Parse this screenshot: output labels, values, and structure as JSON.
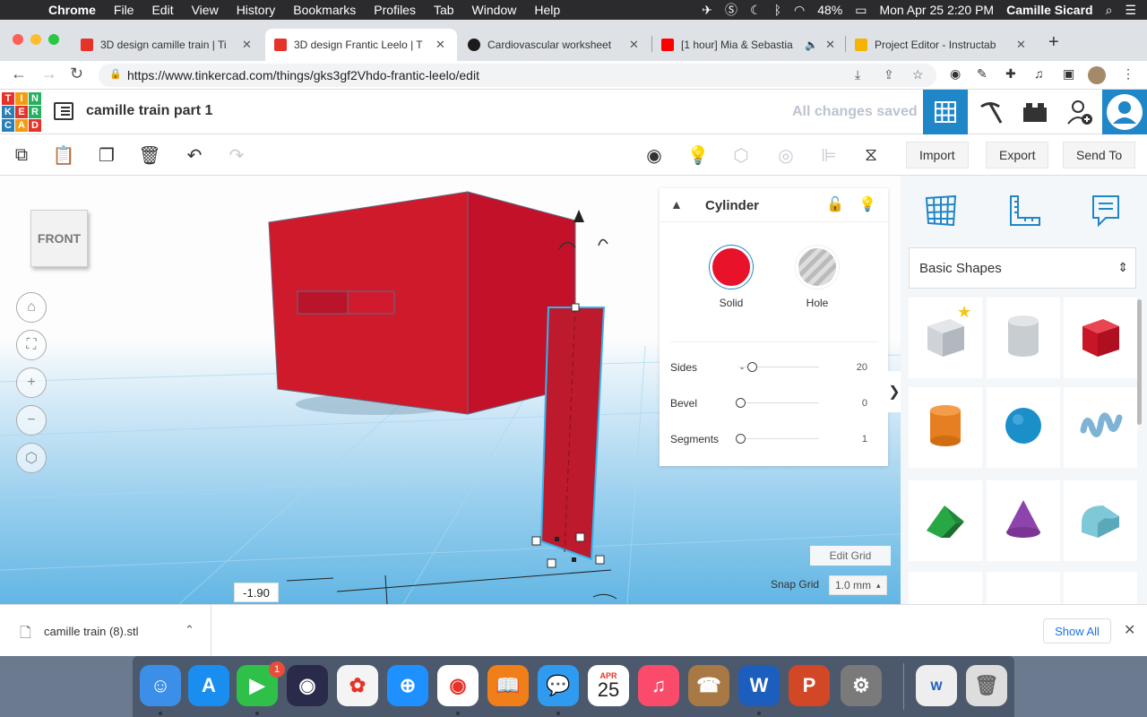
{
  "menubar": {
    "app": "Chrome",
    "items": [
      "File",
      "Edit",
      "View",
      "History",
      "Bookmarks",
      "Profiles",
      "Tab",
      "Window",
      "Help"
    ],
    "battery": "48%",
    "clock": "Mon Apr 25  2:20 PM",
    "user": "Camille Sicard"
  },
  "tabs": [
    {
      "title": "3D design camille train | Ti",
      "favicon_color": "#e6332a"
    },
    {
      "title": "3D design Frantic Leelo | T",
      "favicon_color": "#e6332a",
      "active": true
    },
    {
      "title": "Cardiovascular worksheet",
      "favicon_color": "#1b1b1b"
    },
    {
      "title": "[1 hour] Mia & Sebastia",
      "favicon_color": "#ff0000"
    },
    {
      "title": "Project Editor - Instructab",
      "favicon_color": "#f5b400"
    }
  ],
  "address": {
    "url": "https://www.tinkercad.com/things/gks3gf2Vhdo-frantic-leelo/edit"
  },
  "header": {
    "logo_letters": [
      "T",
      "I",
      "N",
      "K",
      "E",
      "R",
      "C",
      "A",
      "D"
    ],
    "logo_colors": [
      "#e6332a",
      "#f39c12",
      "#27ae60",
      "#2980b9",
      "#e6332a",
      "#27ae60",
      "#2980b9",
      "#f39c12",
      "#e6332a"
    ],
    "title": "camille train part 1",
    "status": "All changes saved",
    "accent": "#1f86c8"
  },
  "toolbar": {
    "import": "Import",
    "export": "Export",
    "send_to": "Send To"
  },
  "viewcube": {
    "label": "FRONT"
  },
  "inspector": {
    "name": "Cylinder",
    "solid_label": "Solid",
    "hole_label": "Hole",
    "solid_color": "#e8132a",
    "props": [
      {
        "label": "Sides",
        "value": "20",
        "min_label": "-",
        "level": 0.1
      },
      {
        "label": "Bevel",
        "value": "0",
        "min_label": "",
        "level": 0
      },
      {
        "label": "Segments",
        "value": "1",
        "min_label": "",
        "level": 0
      }
    ]
  },
  "workplane": {
    "dimension": "-1.90",
    "edit_grid": "Edit Grid",
    "snap_label": "Snap Grid",
    "snap_value": "1.0 mm",
    "snap_arrow": "▴"
  },
  "rpanel": {
    "category": "Basic Shapes"
  },
  "download": {
    "file": "camille train (8).stl",
    "show_all": "Show All"
  },
  "dock": {
    "calendar_month": "APR",
    "calendar_day": "25",
    "facetime_badge": "1"
  }
}
